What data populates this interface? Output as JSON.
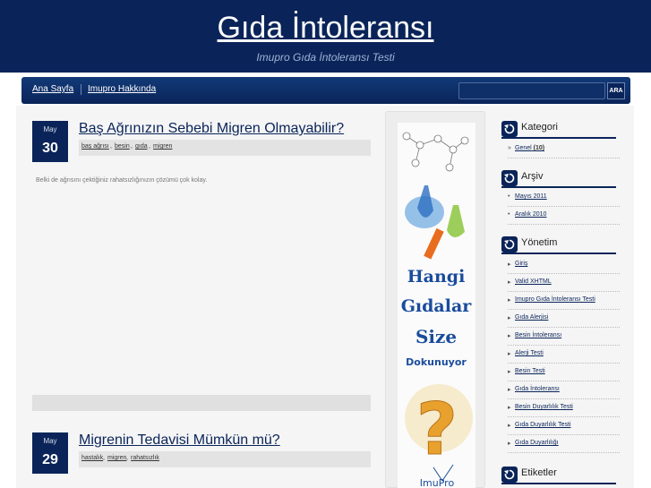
{
  "header": {
    "title": "Gıda İntoleransı",
    "description": "Imupro Gıda İntoleransı Testi"
  },
  "nav": {
    "items": [
      {
        "label": "Ana Sayfa"
      },
      {
        "label": "Imupro Hakkında"
      }
    ],
    "search_button": "ARA"
  },
  "posts": [
    {
      "month": "May",
      "day": "30",
      "title": "Baş Ağrınızın Sebebi Migren Olmayabilir?",
      "tags": [
        "baş ağrısı",
        "besin",
        "gıda",
        "migren"
      ],
      "excerpt": "Belki de ağrısını çektiğiniz rahatsızlığınızın çözümü çok kolay."
    },
    {
      "month": "May",
      "day": "29",
      "title": "Migrenin Tedavisi Mümkün mü?",
      "tags": [
        "hastalık",
        "migren",
        "rahatsızlık"
      ]
    }
  ],
  "ad": {
    "lines": [
      "Hangi",
      "Gıdalar",
      "Size",
      "Dokunuyor"
    ],
    "question_mark": "?",
    "logo_text": "ImuPro"
  },
  "sidebar": {
    "kategori": {
      "title": "Kategori",
      "items": [
        {
          "label": "Genel",
          "count": "(10)"
        }
      ]
    },
    "arsiv": {
      "title": "Arşiv",
      "items": [
        {
          "label": "Mayıs 2011"
        },
        {
          "label": "Aralık 2010"
        }
      ]
    },
    "yonetim": {
      "title": "Yönetim",
      "items": [
        {
          "label": "Giriş"
        },
        {
          "label": "Valid XHTML"
        },
        {
          "label": "Imupro Gıda İntoleransı Testi"
        },
        {
          "label": "Gıda Alerjisi"
        },
        {
          "label": "Besin İntoleransı"
        },
        {
          "label": "Alerji Testi"
        },
        {
          "label": "Besin Testi"
        },
        {
          "label": "Gıda İntoleransı"
        },
        {
          "label": "Besin Duyarlılık Testi"
        },
        {
          "label": "Gıda Duyarlılık Testi"
        },
        {
          "label": "Gıda Duyarlılığı"
        }
      ]
    },
    "etiketler": {
      "title": "Etiketler"
    }
  },
  "colors": {
    "navy": "#0a2459",
    "accent_orange": "#e9a12e"
  }
}
